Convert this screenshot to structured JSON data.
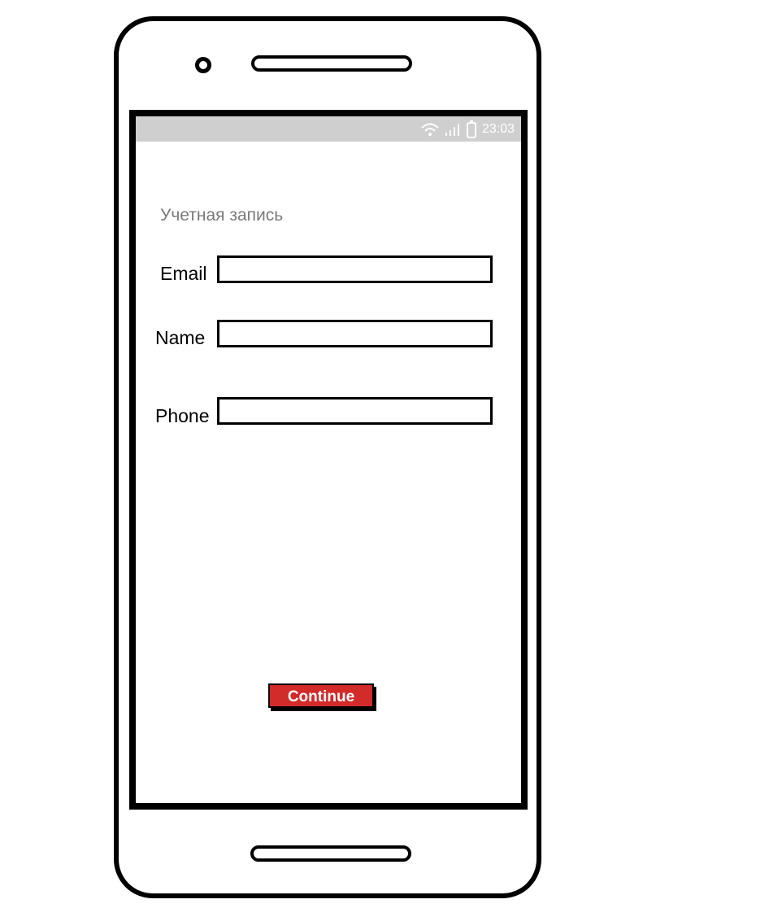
{
  "status_bar": {
    "time": "23:03",
    "icons": [
      "wifi-icon",
      "signal-icon",
      "battery-icon"
    ]
  },
  "form": {
    "title": "Учетная запись",
    "fields": [
      {
        "label": "Email",
        "value": ""
      },
      {
        "label": "Name",
        "value": ""
      },
      {
        "label": "Phone",
        "value": ""
      }
    ],
    "continue_label": "Continue"
  },
  "colors": {
    "button": "#d32a2a",
    "status_bar": "#cfcfcf"
  }
}
